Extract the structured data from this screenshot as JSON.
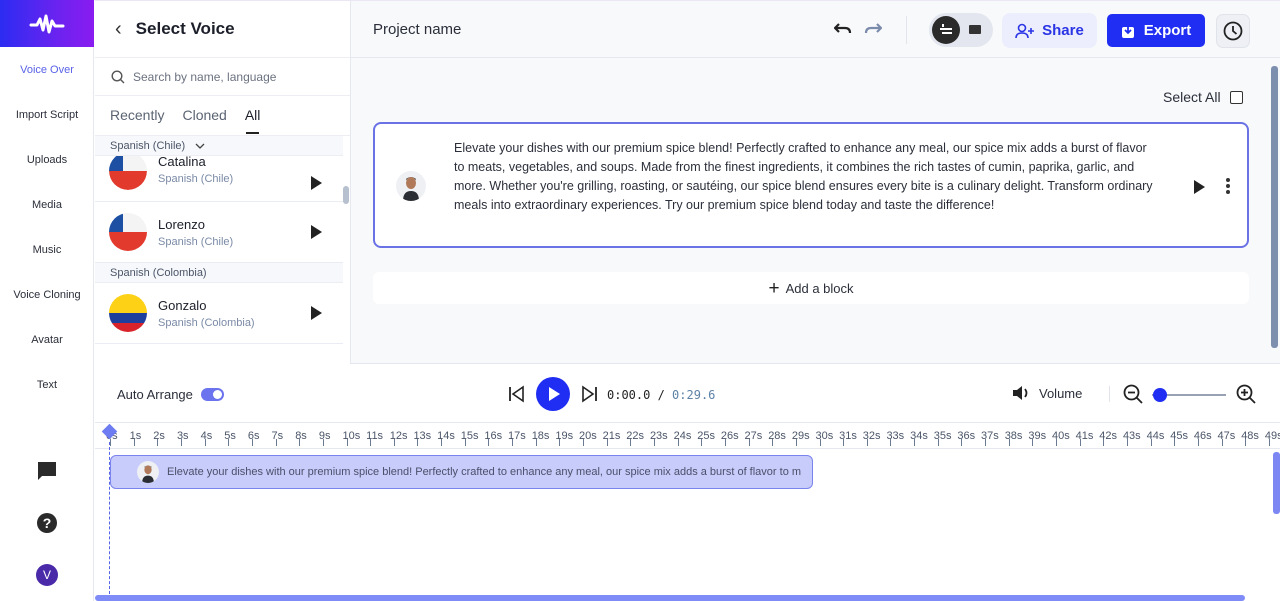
{
  "nav": {
    "logo": "waveform-logo",
    "items": [
      {
        "label": "Voice Over",
        "active": true
      },
      {
        "label": "Import Script"
      },
      {
        "label": "Uploads"
      },
      {
        "label": "Media"
      },
      {
        "label": "Music"
      },
      {
        "label": "Voice Cloning"
      },
      {
        "label": "Avatar"
      },
      {
        "label": "Text"
      }
    ],
    "user_initial": "V"
  },
  "voice_panel": {
    "title": "Select Voice",
    "search_placeholder": "Search by name, language",
    "tabs": [
      {
        "label": "Recently"
      },
      {
        "label": "Cloned"
      },
      {
        "label": "All",
        "active": true
      }
    ],
    "groups": [
      {
        "header": "Spanish (Chile)",
        "voices": [
          {
            "name": "Catalina",
            "lang": "Spanish (Chile)",
            "flag": "chile"
          },
          {
            "name": "Lorenzo",
            "lang": "Spanish (Chile)",
            "flag": "chile"
          }
        ]
      },
      {
        "header": "Spanish (Colombia)",
        "voices": [
          {
            "name": "Gonzalo",
            "lang": "Spanish (Colombia)",
            "flag": "colombia"
          }
        ]
      }
    ]
  },
  "topbar": {
    "project_name": "Project name",
    "share_label": "Share",
    "export_label": "Export",
    "colors": {
      "primary": "#1f2ef2",
      "share_bg": "#eceefd"
    }
  },
  "editor": {
    "select_all_label": "Select All",
    "blocks": [
      {
        "text": "Elevate your dishes with our premium spice blend! Perfectly crafted to enhance any meal, our spice mix adds a burst of flavor to meats, vegetables, and soups. Made from the finest ingredients, it combines the rich tastes of cumin, paprika, garlic, and more. Whether you're grilling, roasting, or sautéing, our spice blend ensures every bite is a culinary delight. Transform ordinary meals into extraordinary experiences. Try our premium spice blend today and taste the difference!"
      }
    ],
    "add_block_label": "Add a block"
  },
  "player": {
    "auto_arrange_label": "Auto Arrange",
    "auto_arrange_on": true,
    "current_time": "0:00.0",
    "separator": " / ",
    "total_time": "0:29.6",
    "volume_label": "Volume"
  },
  "timeline": {
    "ticks": [
      "0s",
      "1s",
      "2s",
      "3s",
      "4s",
      "5s",
      "6s",
      "7s",
      "8s",
      "9s",
      "10s",
      "11s",
      "12s",
      "13s",
      "14s",
      "15s",
      "16s",
      "17s",
      "18s",
      "19s",
      "20s",
      "21s",
      "22s",
      "23s",
      "24s",
      "25s",
      "26s",
      "27s",
      "28s",
      "29s",
      "30s",
      "31s",
      "32s",
      "33s",
      "34s",
      "35s",
      "36s",
      "37s",
      "38s",
      "39s",
      "40s",
      "41s",
      "42s",
      "43s",
      "44s",
      "45s",
      "46s",
      "47s",
      "48s",
      "49s"
    ],
    "clip_text": "Elevate your dishes with our premium spice blend! Perfectly crafted to enhance any meal, our spice mix adds a burst of flavor to m"
  }
}
